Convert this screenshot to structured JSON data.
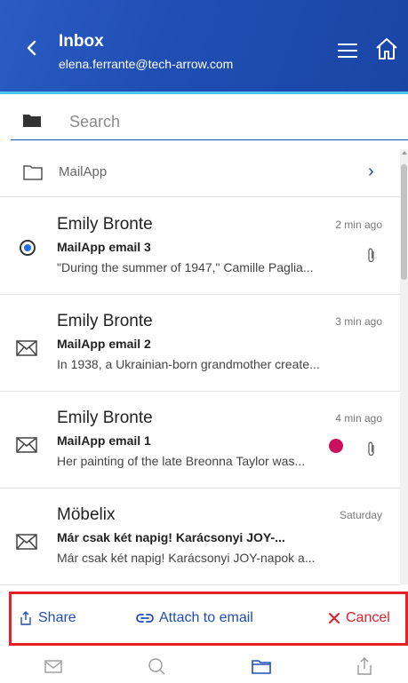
{
  "header": {
    "title": "Inbox",
    "account": "elena.ferrante@tech-arrow.com",
    "icons": [
      "back-icon",
      "hamburger-menu-icon",
      "home-icon"
    ],
    "colors": {
      "background": "#1f4fb4",
      "accent_line": "#4fc3f7"
    }
  },
  "search": {
    "placeholder": "Search",
    "value": ""
  },
  "folder": {
    "label": "MailApp"
  },
  "messages": [
    {
      "sender": "Emily Bronte",
      "subject": "MailApp email 3",
      "preview": "\"During the summer of 1947,\" Camille Paglia...",
      "time": "2 min ago",
      "selected": true,
      "attachment": true,
      "flag": false
    },
    {
      "sender": "Emily Bronte",
      "subject": "MailApp email 2",
      "preview": "In 1938, a Ukrainian-born grandmother create...",
      "time": "3 min ago",
      "selected": false,
      "attachment": false,
      "flag": false
    },
    {
      "sender": "Emily Bronte",
      "subject": "MailApp email 1",
      "preview": "Her painting of the late Breonna Taylor was...",
      "time": "4 min ago",
      "selected": false,
      "attachment": true,
      "flag": true
    },
    {
      "sender": "Möbelix",
      "subject": "Már csak két napig! Karácsonyi JOY-...",
      "preview": "Már csak két napig! Karácsonyi JOY-napok a...",
      "time": "Saturday",
      "selected": false,
      "attachment": false,
      "flag": false
    }
  ],
  "actions": {
    "share": "Share",
    "attach": "Attach to email",
    "cancel": "Cancel"
  },
  "bottom_nav": [
    "mail-icon",
    "search-icon",
    "folder-icon",
    "share-icon"
  ],
  "colors": {
    "primary": "#1f4fb4",
    "cancel": "#e4202b",
    "selected_radio": "#1e6ff0",
    "flag_dot": "#c8105c"
  }
}
